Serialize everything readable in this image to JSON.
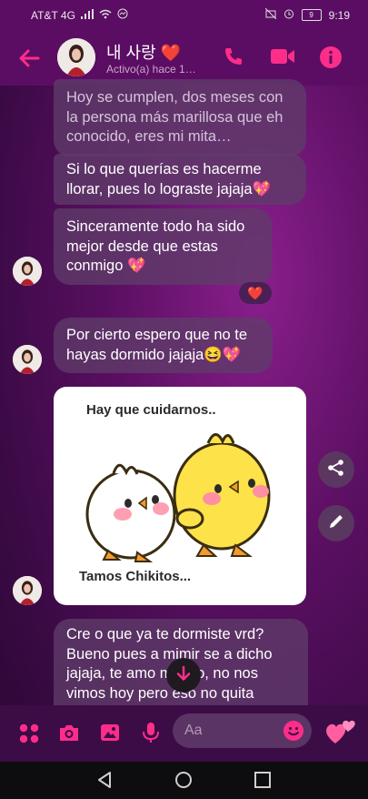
{
  "status_bar": {
    "carrier": "AT&T 4G",
    "battery": "9",
    "time": "9:19"
  },
  "header": {
    "name": "내 사랑 ❤️",
    "status": "Activo(a) hace 1…",
    "icons": [
      "back-arrow-icon",
      "phone-icon",
      "video-call-icon",
      "info-icon"
    ]
  },
  "messages": [
    {
      "text": "Hoy se cumplen, dos meses con la persona más marillosa que eh conocido, eres mi mita…"
    },
    {
      "text": "Si lo que querías es hacerme llorar, pues lo lograste jajaja💖"
    },
    {
      "text": "Sinceramente todo ha sido mejor desde que estas conmigo 💖",
      "reaction": "❤️"
    },
    {
      "text": "Por cierto espero que no te hayas dormido jajaja😆💖"
    },
    {
      "text": "Cre o que ya te dormiste vrd? Bueno pues a mimir se a dicho jajaja, te amo mucho, no nos vimos hoy pero eso no quita"
    }
  ],
  "sticker": {
    "title": "Hay que cuidarnos..",
    "footer": "Tamos Chikitos..."
  },
  "side_buttons": [
    "share-icon",
    "edit-icon"
  ],
  "composer": {
    "placeholder": "Aa",
    "icons": [
      "apps-icon",
      "camera-icon",
      "gallery-icon",
      "microphone-icon",
      "emoji-icon",
      "hearts-icon"
    ]
  },
  "colors": {
    "accent": "#ff2d8a",
    "bubble": "#5f3c69",
    "header": "#5b0d63"
  }
}
